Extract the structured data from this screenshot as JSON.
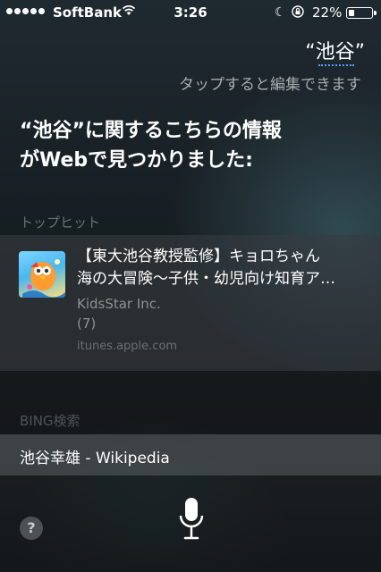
{
  "status_bar": {
    "carrier": "SoftBank",
    "time": "3:26",
    "battery_percent": "22%",
    "battery_level": 0.22,
    "icons": [
      "signal-dots-icon",
      "wifi-icon",
      "moon-icon",
      "orientation-lock-icon",
      "battery-icon"
    ]
  },
  "siri": {
    "query": "“池谷”",
    "tap_to_edit": "タップすると編集できます",
    "response_line1": "“池谷”に関するこちらの情報",
    "response_line2": "がWebで見つかりました:"
  },
  "top_hit": {
    "section_label": "トップヒット",
    "title_line1": "【東大池谷教授監修】キョロちゃん",
    "title_line2": "海の大冒険〜子供・幼児向け知育ア…",
    "developer": "KidsStar Inc.",
    "rating_count": "(7)",
    "source": "itunes.apple.com"
  },
  "bing": {
    "section_label": "BING検索",
    "results": [
      {
        "label": "池谷幸雄 - Wikipedia"
      }
    ]
  },
  "bottom": {
    "help_label": "?",
    "icons": [
      "help-icon",
      "microphone-icon"
    ]
  },
  "colors": {
    "accent_underline": "#5aa0ff",
    "secondary_text": "#a7adb0",
    "muted_text": "#6a7073"
  }
}
